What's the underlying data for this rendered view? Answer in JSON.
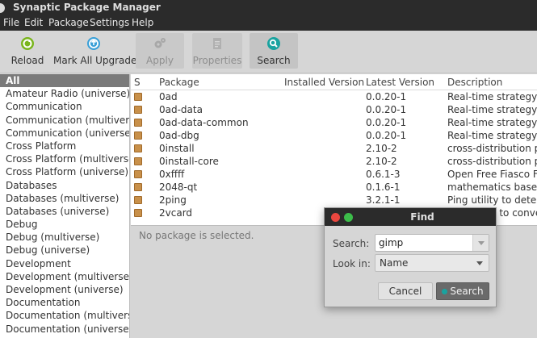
{
  "window": {
    "title": "Synaptic Package Manager"
  },
  "menu": [
    "File",
    "Edit",
    "Package",
    "Settings",
    "Help"
  ],
  "toolbar": {
    "reload": "Reload",
    "mark_all_upgrades": "Mark All Upgrades",
    "apply": "Apply",
    "properties": "Properties",
    "search": "Search"
  },
  "sidebar": {
    "items": [
      "All",
      "Amateur Radio (universe)",
      "Communication",
      "Communication (multiverse)",
      "Communication (universe)",
      "Cross Platform",
      "Cross Platform (multiverse)",
      "Cross Platform (universe)",
      "Databases",
      "Databases (multiverse)",
      "Databases (universe)",
      "Debug",
      "Debug (multiverse)",
      "Debug (universe)",
      "Development",
      "Development (multiverse)",
      "Development (universe)",
      "Documentation",
      "Documentation (multiverse)",
      "Documentation (universe)"
    ]
  },
  "table": {
    "columns": {
      "s": "S",
      "package": "Package",
      "installed": "Installed Version",
      "latest": "Latest Version",
      "description": "Description"
    },
    "rows": [
      {
        "package": "0ad",
        "latest": "0.0.20-1",
        "description": "Real-time strategy game of ancient warfare"
      },
      {
        "package": "0ad-data",
        "latest": "0.0.20-1",
        "description": "Real-time strategy game of ancient warfare"
      },
      {
        "package": "0ad-data-common",
        "latest": "0.0.20-1",
        "description": "Real-time strategy game of ancient warfare"
      },
      {
        "package": "0ad-dbg",
        "latest": "0.0.20-1",
        "description": "Real-time strategy game of ancient warfare"
      },
      {
        "package": "0install",
        "latest": "2.10-2",
        "description": "cross-distribution packaging system"
      },
      {
        "package": "0install-core",
        "latest": "2.10-2",
        "description": "cross-distribution packaging system"
      },
      {
        "package": "0xffff",
        "latest": "0.6.1-3",
        "description": "Open Free Fiasco Firmware Flasher"
      },
      {
        "package": "2048-qt",
        "latest": "0.1.6-1",
        "description": "mathematics based puzzle game"
      },
      {
        "package": "2ping",
        "latest": "3.2.1-1",
        "description": "Ping utility to determine directional packet loss"
      },
      {
        "package": "2vcard",
        "latest": "",
        "description": "perl script to convert an addressbook to VCARD"
      }
    ]
  },
  "details": {
    "empty_text": "No package is selected."
  },
  "find_dialog": {
    "title": "Find",
    "search_label": "Search:",
    "search_value": "gimp",
    "lookin_label": "Look in:",
    "lookin_value": "Name",
    "cancel": "Cancel",
    "search_button": "Search",
    "colors": {
      "close": "#e9473f",
      "maximize": "#3cbd4a"
    }
  }
}
